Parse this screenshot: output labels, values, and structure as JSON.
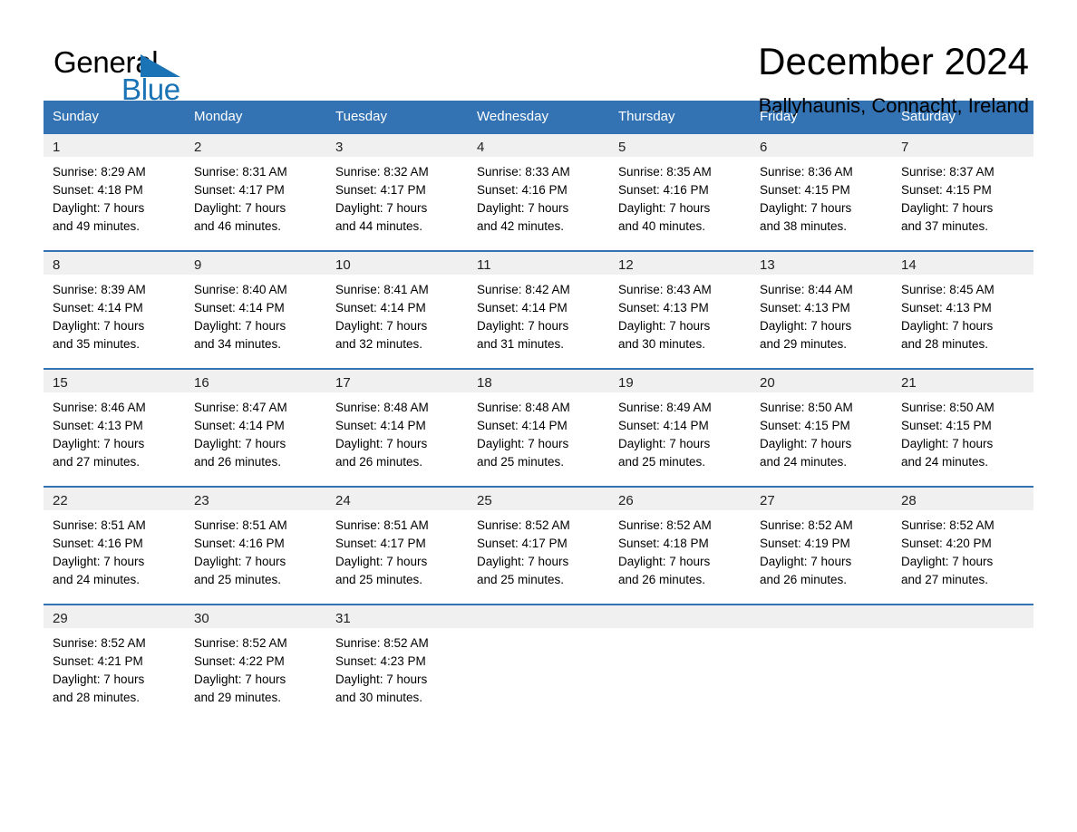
{
  "brand": {
    "name_top": "General",
    "name_bottom": "Blue",
    "accent_color": "#1a73b5"
  },
  "header": {
    "title": "December 2024",
    "subtitle": "Ballyhaunis, Connacht, Ireland"
  },
  "theme": {
    "header_bg": "#3373b4",
    "daynum_bg": "#f0f0f0",
    "text_color": "#000000"
  },
  "weekday_headers": [
    "Sunday",
    "Monday",
    "Tuesday",
    "Wednesday",
    "Thursday",
    "Friday",
    "Saturday"
  ],
  "weeks": [
    [
      {
        "day": "1",
        "sunrise": "Sunrise: 8:29 AM",
        "sunset": "Sunset: 4:18 PM",
        "daylight1": "Daylight: 7 hours",
        "daylight2": "and 49 minutes."
      },
      {
        "day": "2",
        "sunrise": "Sunrise: 8:31 AM",
        "sunset": "Sunset: 4:17 PM",
        "daylight1": "Daylight: 7 hours",
        "daylight2": "and 46 minutes."
      },
      {
        "day": "3",
        "sunrise": "Sunrise: 8:32 AM",
        "sunset": "Sunset: 4:17 PM",
        "daylight1": "Daylight: 7 hours",
        "daylight2": "and 44 minutes."
      },
      {
        "day": "4",
        "sunrise": "Sunrise: 8:33 AM",
        "sunset": "Sunset: 4:16 PM",
        "daylight1": "Daylight: 7 hours",
        "daylight2": "and 42 minutes."
      },
      {
        "day": "5",
        "sunrise": "Sunrise: 8:35 AM",
        "sunset": "Sunset: 4:16 PM",
        "daylight1": "Daylight: 7 hours",
        "daylight2": "and 40 minutes."
      },
      {
        "day": "6",
        "sunrise": "Sunrise: 8:36 AM",
        "sunset": "Sunset: 4:15 PM",
        "daylight1": "Daylight: 7 hours",
        "daylight2": "and 38 minutes."
      },
      {
        "day": "7",
        "sunrise": "Sunrise: 8:37 AM",
        "sunset": "Sunset: 4:15 PM",
        "daylight1": "Daylight: 7 hours",
        "daylight2": "and 37 minutes."
      }
    ],
    [
      {
        "day": "8",
        "sunrise": "Sunrise: 8:39 AM",
        "sunset": "Sunset: 4:14 PM",
        "daylight1": "Daylight: 7 hours",
        "daylight2": "and 35 minutes."
      },
      {
        "day": "9",
        "sunrise": "Sunrise: 8:40 AM",
        "sunset": "Sunset: 4:14 PM",
        "daylight1": "Daylight: 7 hours",
        "daylight2": "and 34 minutes."
      },
      {
        "day": "10",
        "sunrise": "Sunrise: 8:41 AM",
        "sunset": "Sunset: 4:14 PM",
        "daylight1": "Daylight: 7 hours",
        "daylight2": "and 32 minutes."
      },
      {
        "day": "11",
        "sunrise": "Sunrise: 8:42 AM",
        "sunset": "Sunset: 4:14 PM",
        "daylight1": "Daylight: 7 hours",
        "daylight2": "and 31 minutes."
      },
      {
        "day": "12",
        "sunrise": "Sunrise: 8:43 AM",
        "sunset": "Sunset: 4:13 PM",
        "daylight1": "Daylight: 7 hours",
        "daylight2": "and 30 minutes."
      },
      {
        "day": "13",
        "sunrise": "Sunrise: 8:44 AM",
        "sunset": "Sunset: 4:13 PM",
        "daylight1": "Daylight: 7 hours",
        "daylight2": "and 29 minutes."
      },
      {
        "day": "14",
        "sunrise": "Sunrise: 8:45 AM",
        "sunset": "Sunset: 4:13 PM",
        "daylight1": "Daylight: 7 hours",
        "daylight2": "and 28 minutes."
      }
    ],
    [
      {
        "day": "15",
        "sunrise": "Sunrise: 8:46 AM",
        "sunset": "Sunset: 4:13 PM",
        "daylight1": "Daylight: 7 hours",
        "daylight2": "and 27 minutes."
      },
      {
        "day": "16",
        "sunrise": "Sunrise: 8:47 AM",
        "sunset": "Sunset: 4:14 PM",
        "daylight1": "Daylight: 7 hours",
        "daylight2": "and 26 minutes."
      },
      {
        "day": "17",
        "sunrise": "Sunrise: 8:48 AM",
        "sunset": "Sunset: 4:14 PM",
        "daylight1": "Daylight: 7 hours",
        "daylight2": "and 26 minutes."
      },
      {
        "day": "18",
        "sunrise": "Sunrise: 8:48 AM",
        "sunset": "Sunset: 4:14 PM",
        "daylight1": "Daylight: 7 hours",
        "daylight2": "and 25 minutes."
      },
      {
        "day": "19",
        "sunrise": "Sunrise: 8:49 AM",
        "sunset": "Sunset: 4:14 PM",
        "daylight1": "Daylight: 7 hours",
        "daylight2": "and 25 minutes."
      },
      {
        "day": "20",
        "sunrise": "Sunrise: 8:50 AM",
        "sunset": "Sunset: 4:15 PM",
        "daylight1": "Daylight: 7 hours",
        "daylight2": "and 24 minutes."
      },
      {
        "day": "21",
        "sunrise": "Sunrise: 8:50 AM",
        "sunset": "Sunset: 4:15 PM",
        "daylight1": "Daylight: 7 hours",
        "daylight2": "and 24 minutes."
      }
    ],
    [
      {
        "day": "22",
        "sunrise": "Sunrise: 8:51 AM",
        "sunset": "Sunset: 4:16 PM",
        "daylight1": "Daylight: 7 hours",
        "daylight2": "and 24 minutes."
      },
      {
        "day": "23",
        "sunrise": "Sunrise: 8:51 AM",
        "sunset": "Sunset: 4:16 PM",
        "daylight1": "Daylight: 7 hours",
        "daylight2": "and 25 minutes."
      },
      {
        "day": "24",
        "sunrise": "Sunrise: 8:51 AM",
        "sunset": "Sunset: 4:17 PM",
        "daylight1": "Daylight: 7 hours",
        "daylight2": "and 25 minutes."
      },
      {
        "day": "25",
        "sunrise": "Sunrise: 8:52 AM",
        "sunset": "Sunset: 4:17 PM",
        "daylight1": "Daylight: 7 hours",
        "daylight2": "and 25 minutes."
      },
      {
        "day": "26",
        "sunrise": "Sunrise: 8:52 AM",
        "sunset": "Sunset: 4:18 PM",
        "daylight1": "Daylight: 7 hours",
        "daylight2": "and 26 minutes."
      },
      {
        "day": "27",
        "sunrise": "Sunrise: 8:52 AM",
        "sunset": "Sunset: 4:19 PM",
        "daylight1": "Daylight: 7 hours",
        "daylight2": "and 26 minutes."
      },
      {
        "day": "28",
        "sunrise": "Sunrise: 8:52 AM",
        "sunset": "Sunset: 4:20 PM",
        "daylight1": "Daylight: 7 hours",
        "daylight2": "and 27 minutes."
      }
    ],
    [
      {
        "day": "29",
        "sunrise": "Sunrise: 8:52 AM",
        "sunset": "Sunset: 4:21 PM",
        "daylight1": "Daylight: 7 hours",
        "daylight2": "and 28 minutes."
      },
      {
        "day": "30",
        "sunrise": "Sunrise: 8:52 AM",
        "sunset": "Sunset: 4:22 PM",
        "daylight1": "Daylight: 7 hours",
        "daylight2": "and 29 minutes."
      },
      {
        "day": "31",
        "sunrise": "Sunrise: 8:52 AM",
        "sunset": "Sunset: 4:23 PM",
        "daylight1": "Daylight: 7 hours",
        "daylight2": "and 30 minutes."
      },
      {
        "day": "",
        "sunrise": "",
        "sunset": "",
        "daylight1": "",
        "daylight2": "",
        "blank": true
      },
      {
        "day": "",
        "sunrise": "",
        "sunset": "",
        "daylight1": "",
        "daylight2": "",
        "blank": true
      },
      {
        "day": "",
        "sunrise": "",
        "sunset": "",
        "daylight1": "",
        "daylight2": "",
        "blank": true
      },
      {
        "day": "",
        "sunrise": "",
        "sunset": "",
        "daylight1": "",
        "daylight2": "",
        "blank": true
      }
    ]
  ]
}
